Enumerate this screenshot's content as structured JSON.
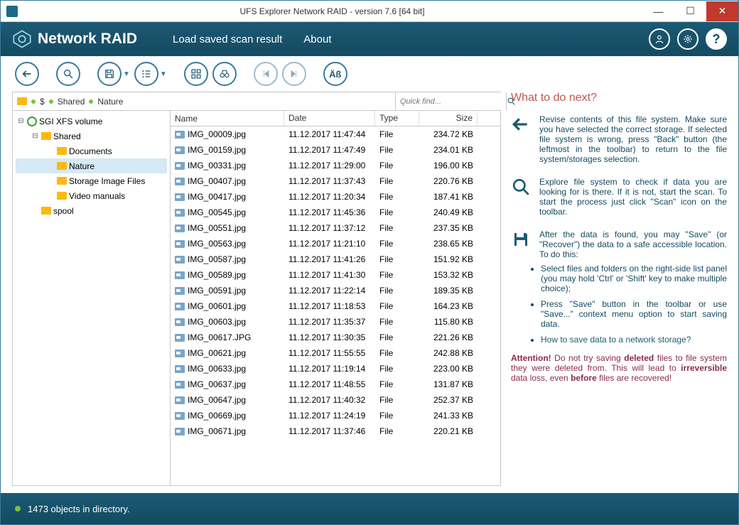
{
  "window": {
    "title": "UFS Explorer Network RAID - version 7.6 [64 bit]"
  },
  "brand": {
    "name": "Network RAID"
  },
  "menu": {
    "load": "Load saved scan result",
    "about": "About"
  },
  "breadcrumb": {
    "p1": "$",
    "p2": "Shared",
    "p3": "Nature"
  },
  "quickfind": {
    "placeholder": "Quick find..."
  },
  "tree": {
    "root": "SGI XFS volume",
    "shared": "Shared",
    "documents": "Documents",
    "nature": "Nature",
    "storage": "Storage Image Files",
    "video": "Video manuals",
    "spool": "spool"
  },
  "columns": {
    "name": "Name",
    "date": "Date",
    "type": "Type",
    "size": "Size"
  },
  "files": [
    {
      "name": "IMG_00009.jpg",
      "date": "11.12.2017 11:47:44",
      "type": "File",
      "size": "234.72 KB"
    },
    {
      "name": "IMG_00159.jpg",
      "date": "11.12.2017 11:47:49",
      "type": "File",
      "size": "234.01 KB"
    },
    {
      "name": "IMG_00331.jpg",
      "date": "11.12.2017 11:29:00",
      "type": "File",
      "size": "196.00 KB"
    },
    {
      "name": "IMG_00407.jpg",
      "date": "11.12.2017 11:37:43",
      "type": "File",
      "size": "220.76 KB"
    },
    {
      "name": "IMG_00417.jpg",
      "date": "11.12.2017 11:20:34",
      "type": "File",
      "size": "187.41 KB"
    },
    {
      "name": "IMG_00545.jpg",
      "date": "11.12.2017 11:45:36",
      "type": "File",
      "size": "240.49 KB"
    },
    {
      "name": "IMG_00551.jpg",
      "date": "11.12.2017 11:37:12",
      "type": "File",
      "size": "237.35 KB"
    },
    {
      "name": "IMG_00563.jpg",
      "date": "11.12.2017 11:21:10",
      "type": "File",
      "size": "238.65 KB"
    },
    {
      "name": "IMG_00587.jpg",
      "date": "11.12.2017 11:41:26",
      "type": "File",
      "size": "151.92 KB"
    },
    {
      "name": "IMG_00589.jpg",
      "date": "11.12.2017 11:41:30",
      "type": "File",
      "size": "153.32 KB"
    },
    {
      "name": "IMG_00591.jpg",
      "date": "11.12.2017 11:22:14",
      "type": "File",
      "size": "189.35 KB"
    },
    {
      "name": "IMG_00601.jpg",
      "date": "11.12.2017 11:18:53",
      "type": "File",
      "size": "164.23 KB"
    },
    {
      "name": "IMG_00603.jpg",
      "date": "11.12.2017 11:35:37",
      "type": "File",
      "size": "115.80 KB"
    },
    {
      "name": "IMG_00617.JPG",
      "date": "11.12.2017 11:30:35",
      "type": "File",
      "size": "221.26 KB"
    },
    {
      "name": "IMG_00621.jpg",
      "date": "11.12.2017 11:55:55",
      "type": "File",
      "size": "242.88 KB"
    },
    {
      "name": "IMG_00633.jpg",
      "date": "11.12.2017 11:19:14",
      "type": "File",
      "size": "223.00 KB"
    },
    {
      "name": "IMG_00637.jpg",
      "date": "11.12.2017 11:48:55",
      "type": "File",
      "size": "131.87 KB"
    },
    {
      "name": "IMG_00647.jpg",
      "date": "11.12.2017 11:40:32",
      "type": "File",
      "size": "252.37 KB"
    },
    {
      "name": "IMG_00669.jpg",
      "date": "11.12.2017 11:24:19",
      "type": "File",
      "size": "241.33 KB"
    },
    {
      "name": "IMG_00671.jpg",
      "date": "11.12.2017 11:37:46",
      "type": "File",
      "size": "220.21 KB"
    }
  ],
  "help": {
    "title": "What to do next?",
    "p1": "Revise contents of this file system. Make sure you have selected the correct storage. If selected file system is wrong, press \"Back\" button (the leftmost in the toolbar) to return to the file system/storages selection.",
    "p2": "Explore file system to check if data you are looking for is there. If it is not, start the scan. To start the process just click \"Scan\" icon on the toolbar.",
    "p3": "After the data is found, you may \"Save\" (or \"Recover\") the data to a safe accessible location. To do this:",
    "li1": "Select files and folders on the right-side list panel (you may hold 'Ctrl' or 'Shift' key to make multiple choice);",
    "li2": "Press \"Save\" button in the toolbar or use \"Save...\" context menu option to start saving data.",
    "link": "How to save data to a network storage?",
    "attn_label": "Attention!",
    "attn_1": " Do not try saving ",
    "attn_b1": "deleted",
    "attn_2": " files to file system they were deleted from. This will lead to ",
    "attn_b2": "irreversible",
    "attn_3": " data loss, even ",
    "attn_b3": "before",
    "attn_4": " files are recovered!"
  },
  "status": {
    "text": "1473 objects in directory."
  }
}
